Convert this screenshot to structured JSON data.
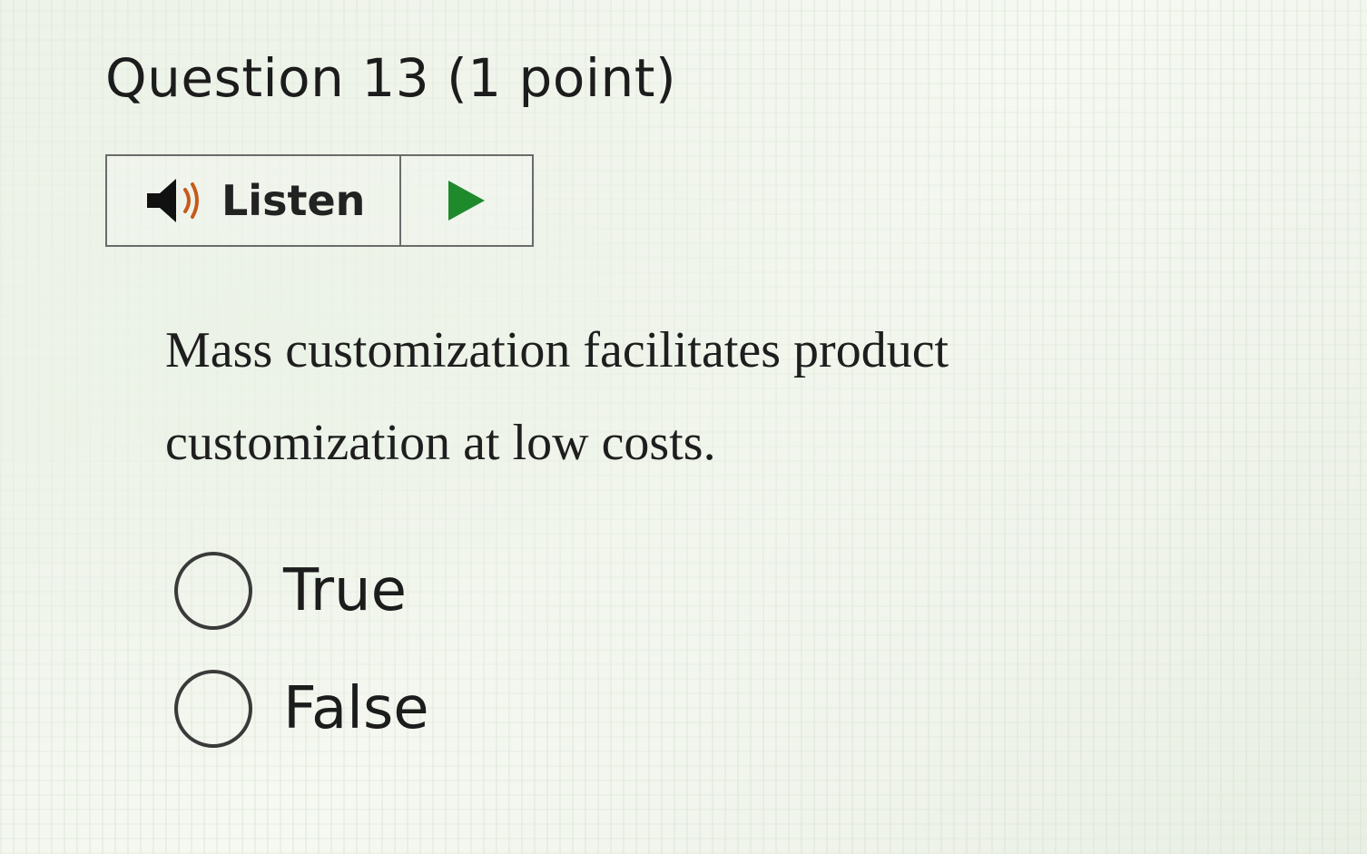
{
  "question": {
    "title": "Question 13 (1 point)",
    "text": "Mass customization facilitates product customization at low costs."
  },
  "listen": {
    "label": "Listen",
    "speaker_icon": "speaker-icon",
    "play_icon": "play-icon",
    "play_color": "#1e8a2c"
  },
  "options": [
    {
      "label": "True",
      "selected": false
    },
    {
      "label": "False",
      "selected": false
    }
  ]
}
